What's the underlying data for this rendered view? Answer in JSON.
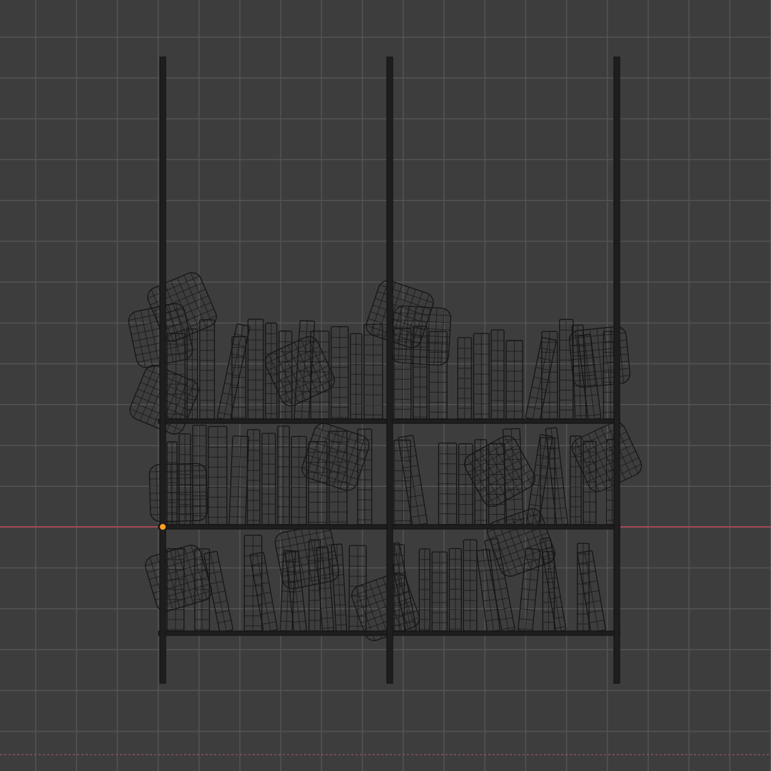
{
  "viewport": {
    "origin": {
      "selected": true
    }
  }
}
